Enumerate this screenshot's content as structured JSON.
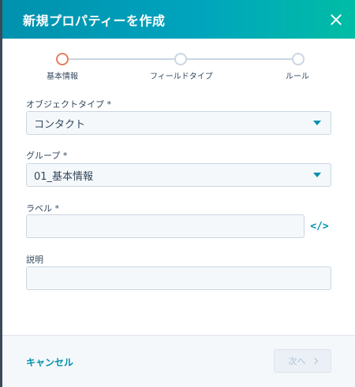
{
  "dialog": {
    "title": "新規プロパティーを作成"
  },
  "stepper": {
    "steps": [
      {
        "label": "基本情報",
        "active": true
      },
      {
        "label": "フィールドタイプ",
        "active": false
      },
      {
        "label": "ルール",
        "active": false
      }
    ]
  },
  "form": {
    "object_type": {
      "label": "オブジェクトタイプ *",
      "value": "コンタクト"
    },
    "group": {
      "label": "グループ *",
      "value": "01_基本情報"
    },
    "label_field": {
      "label": "ラベル *",
      "value": ""
    },
    "description": {
      "label": "説明",
      "value": ""
    }
  },
  "footer": {
    "cancel_label": "キャンセル",
    "next_label": "次へ"
  },
  "colors": {
    "accent": "#0091ae",
    "active_step": "#e57f5e",
    "field_bg": "#f5f8fa"
  }
}
